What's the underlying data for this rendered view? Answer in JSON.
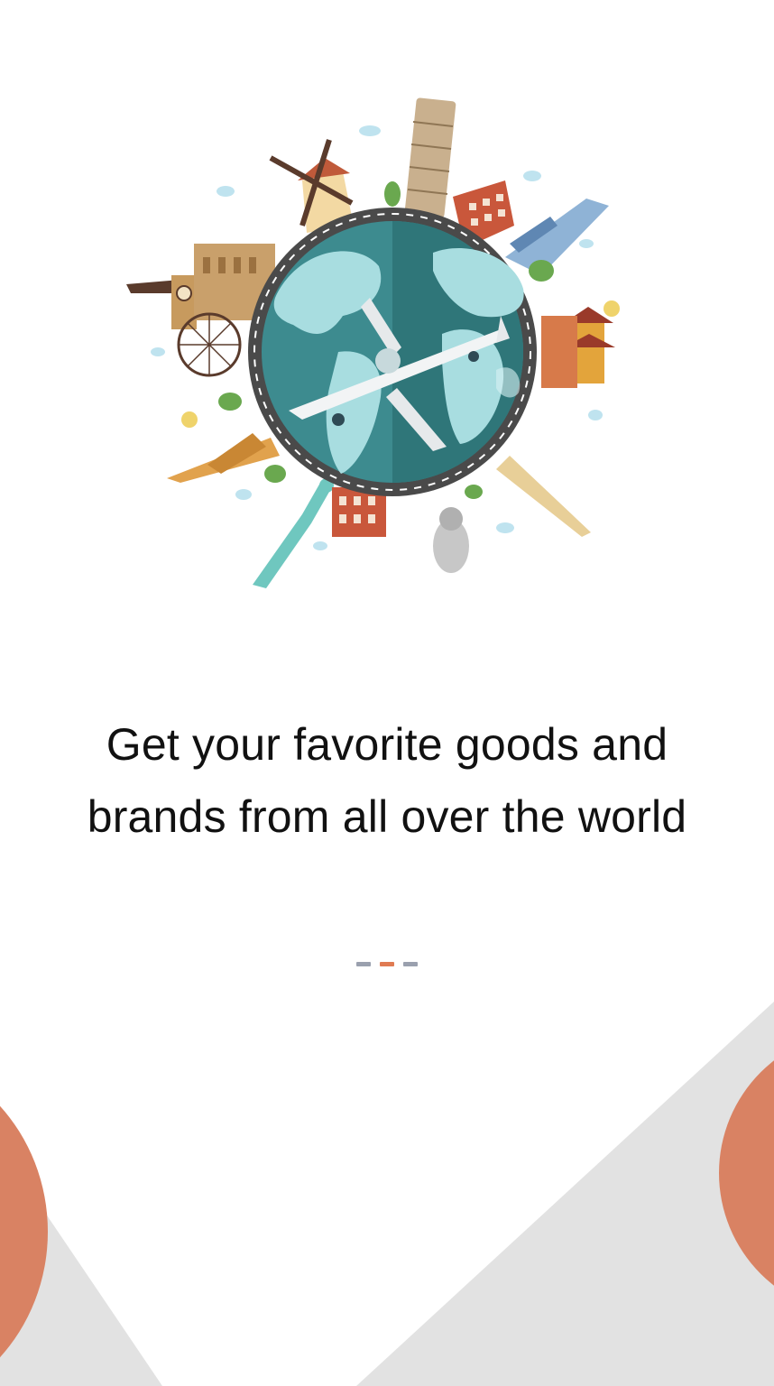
{
  "onboarding": {
    "headline_line1": "Get your favorite goods and",
    "headline_line2": "brands from all over the world",
    "illustration": "world-landmarks-globe-with-airplane",
    "pager": {
      "pages": 3,
      "current_page": 2
    }
  },
  "colors": {
    "accent": "#e07b52",
    "indicator_inactive": "#9aa0ae",
    "background": "#ffffff",
    "shape_gray": "#e2e2e2",
    "ocean": "#3d8b8f",
    "land": "#a8dde0"
  }
}
